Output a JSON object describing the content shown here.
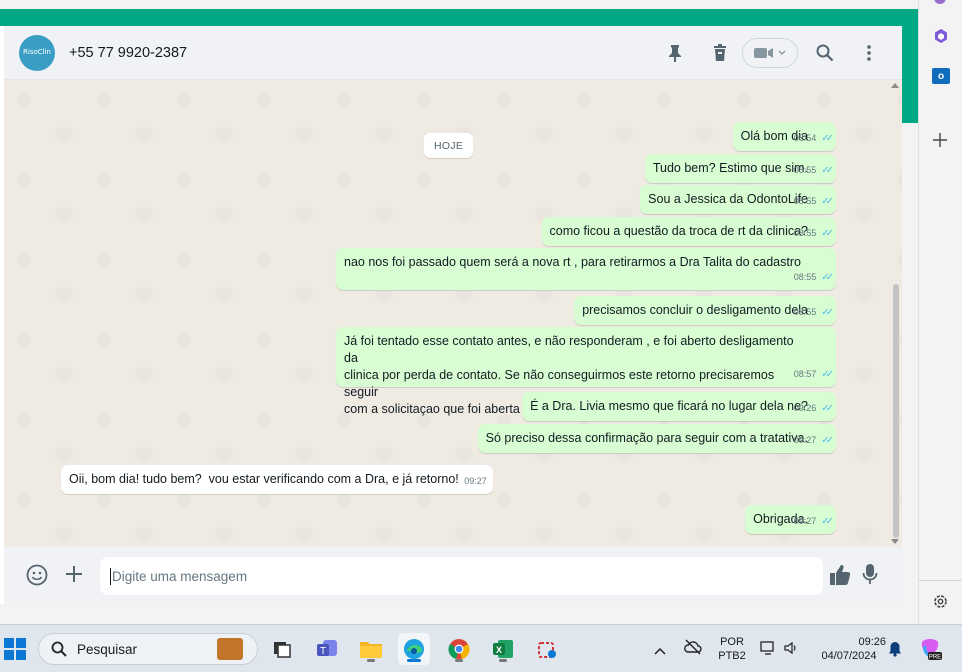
{
  "chat": {
    "contact_name": "+55 77 9920-2387",
    "avatar_text": "RisoClin",
    "date_chip": "HOJE",
    "input_placeholder": "Digite uma mensagem"
  },
  "messages": [
    {
      "dir": "out",
      "text": "Olá bom dia",
      "time": "08:54"
    },
    {
      "dir": "out",
      "text": "Tudo bem? Estimo que sim.",
      "time": "08:55"
    },
    {
      "dir": "out",
      "text": "Sou a Jessica da OdontoLife",
      "time": "08:55"
    },
    {
      "dir": "out",
      "text": "como ficou a questão da troca de rt da clinica?",
      "time": "08:55"
    },
    {
      "dir": "out",
      "text": "nao nos foi passado quem será a nova rt , para retirarmos a Dra Talita do cadastro",
      "time": "08:55"
    },
    {
      "dir": "out",
      "text": "precisamos concluir o desligamento dela",
      "time": "08:55"
    },
    {
      "dir": "out",
      "text": "Já foi tentado esse contato antes, e não responderam , e foi aberto desligamento da\nclinica por perda de contato. Se não conseguirmos este retorno precisaremos seguir\ncom a solicitaçao que foi aberta da desativação por perda de contato.",
      "time": "08:57"
    },
    {
      "dir": "out",
      "text": "É a Dra. Livia mesmo que ficará no lugar dela ne?",
      "time": "09:26"
    },
    {
      "dir": "out",
      "text": "Só preciso dessa confirmação para seguir com a tratativa.",
      "time": "09:27"
    },
    {
      "dir": "in",
      "text": "Oii, bom dia! tudo bem?  vou estar verificando com a Dra, e já retorno!",
      "time": "09:27"
    },
    {
      "dir": "out",
      "text": "Obrigada.",
      "time": "09:27"
    }
  ],
  "taskbar": {
    "search_placeholder": "Pesquisar",
    "lang_top": "POR",
    "lang_bottom": "PTB2",
    "clock_time": "09:26",
    "clock_date": "04/07/2024"
  },
  "colors": {
    "whatsapp_green": "#00a884",
    "outgoing_bubble": "#d9fdd3",
    "incoming_bubble": "#ffffff",
    "read_ticks": "#53bdeb"
  }
}
